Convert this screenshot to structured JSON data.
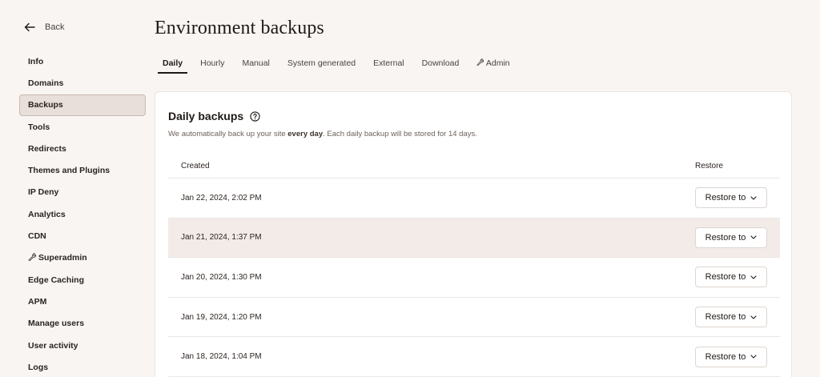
{
  "sidebar": {
    "back_label": "Back",
    "items": [
      {
        "label": "Info",
        "active": false
      },
      {
        "label": "Domains",
        "active": false
      },
      {
        "label": "Backups",
        "active": true
      },
      {
        "label": "Tools",
        "active": false
      },
      {
        "label": "Redirects",
        "active": false
      },
      {
        "label": "Themes and Plugins",
        "active": false
      },
      {
        "label": "IP Deny",
        "active": false
      },
      {
        "label": "Analytics",
        "active": false
      },
      {
        "label": "CDN",
        "active": false
      },
      {
        "label": "Superadmin",
        "active": false,
        "icon": "wrench-icon"
      },
      {
        "label": "Edge Caching",
        "active": false
      },
      {
        "label": "APM",
        "active": false
      },
      {
        "label": "Manage users",
        "active": false
      },
      {
        "label": "User activity",
        "active": false
      },
      {
        "label": "Logs",
        "active": false
      }
    ]
  },
  "header": {
    "title": "Environment backups"
  },
  "tabs": [
    {
      "label": "Daily",
      "active": true
    },
    {
      "label": "Hourly",
      "active": false
    },
    {
      "label": "Manual",
      "active": false
    },
    {
      "label": "System generated",
      "active": false
    },
    {
      "label": "External",
      "active": false
    },
    {
      "label": "Download",
      "active": false
    },
    {
      "label": "Admin",
      "active": false,
      "icon": "wrench-icon"
    }
  ],
  "card": {
    "title": "Daily backups",
    "desc_before": "We automatically back up your site ",
    "desc_bold": "every day",
    "desc_after": ". Each daily backup will be stored for 14 days."
  },
  "table": {
    "col_created": "Created",
    "col_restore": "Restore",
    "restore_label": "Restore to",
    "rows": [
      {
        "created": "Jan 22, 2024, 2:02 PM",
        "highlight": false
      },
      {
        "created": "Jan 21, 2024, 1:37 PM",
        "highlight": true
      },
      {
        "created": "Jan 20, 2024, 1:30 PM",
        "highlight": false
      },
      {
        "created": "Jan 19, 2024, 1:20 PM",
        "highlight": false
      },
      {
        "created": "Jan 18, 2024, 1:04 PM",
        "highlight": false
      }
    ]
  },
  "colors": {
    "background": "#f8f5f2",
    "active_nav": "#e8dfda",
    "row_highlight": "#f3ebe8",
    "text": "#1f1a17"
  }
}
